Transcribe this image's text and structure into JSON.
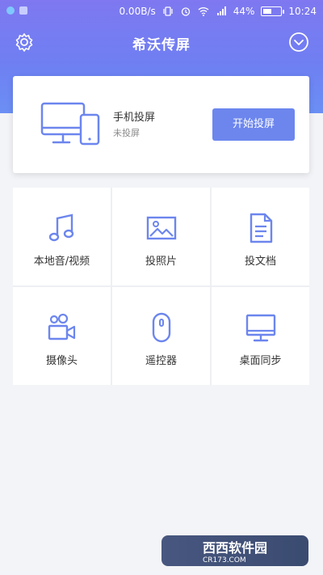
{
  "status_bar": {
    "speed": "0.00B/s",
    "battery": "44%",
    "time": "10:24"
  },
  "app_bar": {
    "title": "希沃传屏",
    "left_icon": "settings-icon",
    "right_icon": "chevron-down-circle-icon"
  },
  "cast_card": {
    "title": "手机投屏",
    "subtitle": "未投屏",
    "button_label": "开始投屏",
    "icon": "monitor-phone-icon"
  },
  "features": [
    {
      "label": "本地音/视频",
      "icon": "music-note-icon"
    },
    {
      "label": "投照片",
      "icon": "image-icon"
    },
    {
      "label": "投文档",
      "icon": "document-icon"
    },
    {
      "label": "摄像头",
      "icon": "camera-icon"
    },
    {
      "label": "遥控器",
      "icon": "mouse-icon"
    },
    {
      "label": "桌面同步",
      "icon": "monitor-icon"
    }
  ],
  "watermark": {
    "brand": "西西软件园",
    "domain": "CR173.COM"
  },
  "colors": {
    "header_top": "#7f78f0",
    "header_bottom": "#6b8ff4",
    "accent": "#6c86ee",
    "background": "#f3f4f7"
  }
}
